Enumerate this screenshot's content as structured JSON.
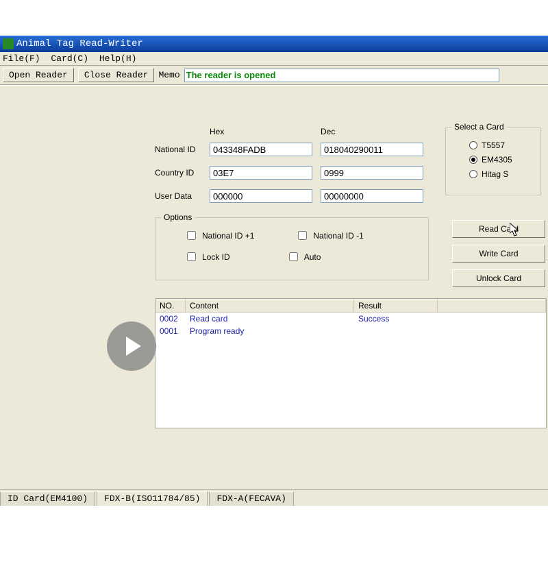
{
  "window": {
    "title": "Animal Tag Read-Writer"
  },
  "menu": {
    "file": "File(F)",
    "card": "Card(C)",
    "help": "Help(H)"
  },
  "toolbar": {
    "open_reader": "Open Reader",
    "close_reader": "Close Reader",
    "memo_label": "Memo",
    "memo_value": "The reader is opened"
  },
  "cols": {
    "hex": "Hex",
    "dec": "Dec"
  },
  "fields": {
    "national_id": {
      "label": "National ID",
      "hex": "043348FADB",
      "dec": "018040290011"
    },
    "country_id": {
      "label": "Country ID",
      "hex": "03E7",
      "dec": "0999"
    },
    "user_data": {
      "label": "User Data",
      "hex": "000000",
      "dec": "00000000"
    }
  },
  "options": {
    "legend": "Options",
    "nat_plus": "National ID +1",
    "nat_minus": "National ID -1",
    "lock_id": "Lock ID",
    "auto": "Auto"
  },
  "select_card": {
    "legend": "Select a Card",
    "items": [
      "T5557",
      "EM4305",
      "Hitag S"
    ],
    "selected": "EM4305"
  },
  "actions": {
    "read": "Read Card",
    "write": "Write Card",
    "unlock": "Unlock Card"
  },
  "log": {
    "headers": {
      "no": "NO.",
      "content": "Content",
      "result": "Result"
    },
    "rows": [
      {
        "no": "0002",
        "content": "Read card",
        "result": "Success"
      },
      {
        "no": "0001",
        "content": "Program ready",
        "result": ""
      }
    ]
  },
  "tabs": {
    "items": [
      "ID Card(EM4100)",
      "FDX-B(ISO11784/85)",
      "FDX-A(FECAVA)"
    ],
    "active_index": 1
  }
}
